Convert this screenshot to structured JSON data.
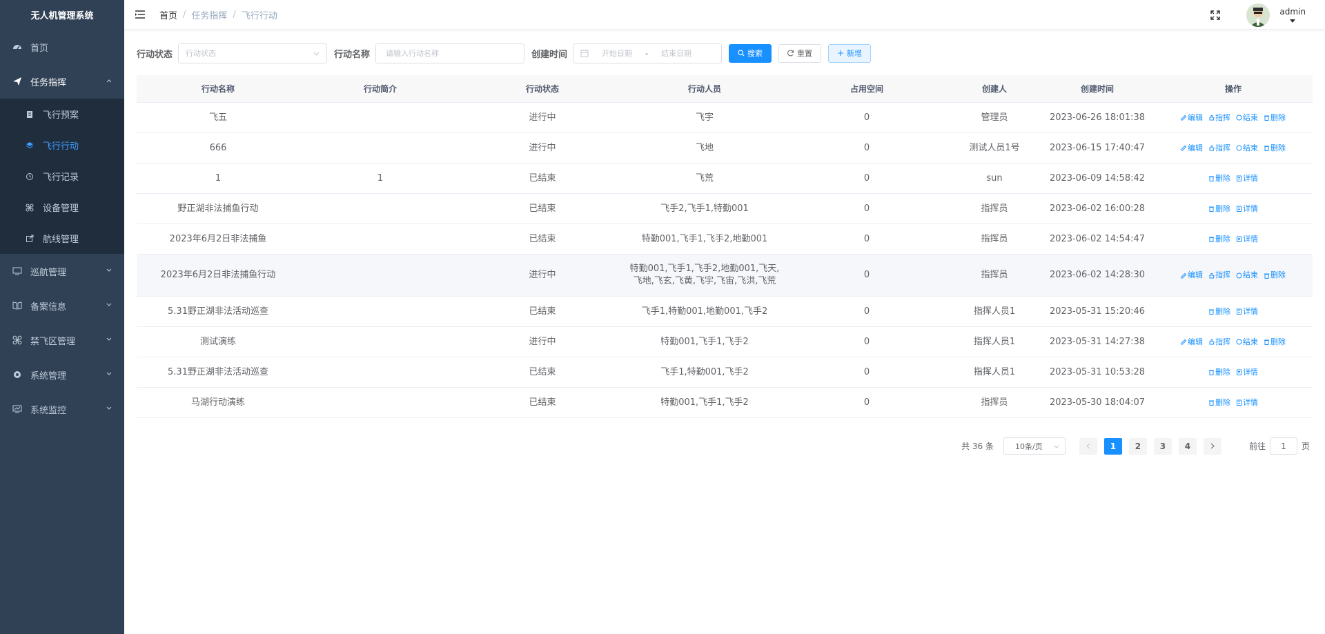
{
  "app": {
    "title": "无人机管理系统"
  },
  "sidebar": {
    "items": [
      {
        "label": "首页",
        "icon": "dashboard-icon"
      },
      {
        "label": "任务指挥",
        "icon": "send-icon",
        "expanded": true,
        "children": [
          {
            "label": "飞行预案",
            "icon": "document-icon"
          },
          {
            "label": "飞行行动",
            "icon": "layers-icon",
            "active": true
          },
          {
            "label": "飞行记录",
            "icon": "history-icon"
          },
          {
            "label": "设备管理",
            "icon": "drone-icon"
          },
          {
            "label": "航线管理",
            "icon": "external-link-icon"
          }
        ]
      },
      {
        "label": "巡航管理",
        "icon": "monitor-icon"
      },
      {
        "label": "备案信息",
        "icon": "book-icon"
      },
      {
        "label": "禁飞区管理",
        "icon": "drone-icon"
      },
      {
        "label": "系统管理",
        "icon": "gear-icon"
      },
      {
        "label": "系统监控",
        "icon": "monitor-chart-icon"
      }
    ]
  },
  "header": {
    "breadcrumb": [
      "首页",
      "任务指挥",
      "飞行行动"
    ],
    "user": "admin"
  },
  "filters": {
    "status_label": "行动状态",
    "status_placeholder": "行动状态",
    "name_label": "行动名称",
    "name_placeholder": "请输入行动名称",
    "time_label": "创建时间",
    "start_placeholder": "开始日期",
    "date_sep": "-",
    "end_placeholder": "结束日期",
    "search_btn": "搜索",
    "reset_btn": "重置",
    "add_btn": "新增"
  },
  "table": {
    "columns": [
      "行动名称",
      "行动简介",
      "行动状态",
      "行动人员",
      "占用空间",
      "创建人",
      "创建时间",
      "操作"
    ],
    "rows": [
      {
        "name": "飞五",
        "intro": "",
        "status": "进行中",
        "members": "飞宇",
        "space": "0",
        "creator": "管理员",
        "created": "2023-06-26 18:01:38",
        "ops": [
          "编辑",
          "指挥",
          "结束",
          "删除"
        ]
      },
      {
        "name": "666",
        "intro": "",
        "status": "进行中",
        "members": "飞地",
        "space": "0",
        "creator": "测试人员1号",
        "created": "2023-06-15 17:40:47",
        "ops": [
          "编辑",
          "指挥",
          "结束",
          "删除"
        ]
      },
      {
        "name": "1",
        "intro": "1",
        "status": "已结束",
        "members": "飞荒",
        "space": "0",
        "creator": "sun",
        "created": "2023-06-09 14:58:42",
        "ops": [
          "删除",
          "详情"
        ]
      },
      {
        "name": "野正湖非法捕鱼行动",
        "intro": "",
        "status": "已结束",
        "members": "飞手2,飞手1,特勤001",
        "space": "0",
        "creator": "指挥员",
        "created": "2023-06-02 16:00:28",
        "ops": [
          "删除",
          "详情"
        ]
      },
      {
        "name": "2023年6月2日非法捕鱼",
        "intro": "",
        "status": "已结束",
        "members": "特勤001,飞手1,飞手2,地勤001",
        "space": "0",
        "creator": "指挥员",
        "created": "2023-06-02 14:54:47",
        "ops": [
          "删除",
          "详情"
        ]
      },
      {
        "name": "2023年6月2日非法捕鱼行动",
        "intro": "",
        "status": "进行中",
        "members": "特勤001,飞手1,飞手2,地勤001,飞天,飞地,飞玄,飞黄,飞宇,飞宙,飞洪,飞荒",
        "space": "0",
        "creator": "指挥员",
        "created": "2023-06-02 14:28:30",
        "ops": [
          "编辑",
          "指挥",
          "结束",
          "删除"
        ]
      },
      {
        "name": "5.31野正湖非法活动巡查",
        "intro": "",
        "status": "已结束",
        "members": "飞手1,特勤001,地勤001,飞手2",
        "space": "0",
        "creator": "指挥人员1",
        "created": "2023-05-31 15:20:46",
        "ops": [
          "删除",
          "详情"
        ]
      },
      {
        "name": "测试演练",
        "intro": "",
        "status": "进行中",
        "members": "特勤001,飞手1,飞手2",
        "space": "0",
        "creator": "指挥人员1",
        "created": "2023-05-31 14:27:38",
        "ops": [
          "编辑",
          "指挥",
          "结束",
          "删除"
        ]
      },
      {
        "name": "5.31野正湖非法活动巡查",
        "intro": "",
        "status": "已结束",
        "members": "飞手1,特勤001,飞手2",
        "space": "0",
        "creator": "指挥人员1",
        "created": "2023-05-31 10:53:28",
        "ops": [
          "删除",
          "详情"
        ]
      },
      {
        "name": "马湖行动演练",
        "intro": "",
        "status": "已结束",
        "members": "特勤001,飞手1,飞手2",
        "space": "0",
        "creator": "指挥员",
        "created": "2023-05-30 18:04:07",
        "ops": [
          "删除",
          "详情"
        ]
      }
    ]
  },
  "pagination": {
    "total": "共 36 条",
    "page_size": "10条/页",
    "pages": [
      "1",
      "2",
      "3",
      "4"
    ],
    "current": "1",
    "goto_prefix": "前往",
    "goto_value": "1",
    "goto_suffix": "页"
  },
  "colors": {
    "primary": "#1890ff",
    "sidebar_bg": "#304156",
    "submenu_bg": "#1f2d3d",
    "active_menu": "#409eff"
  }
}
